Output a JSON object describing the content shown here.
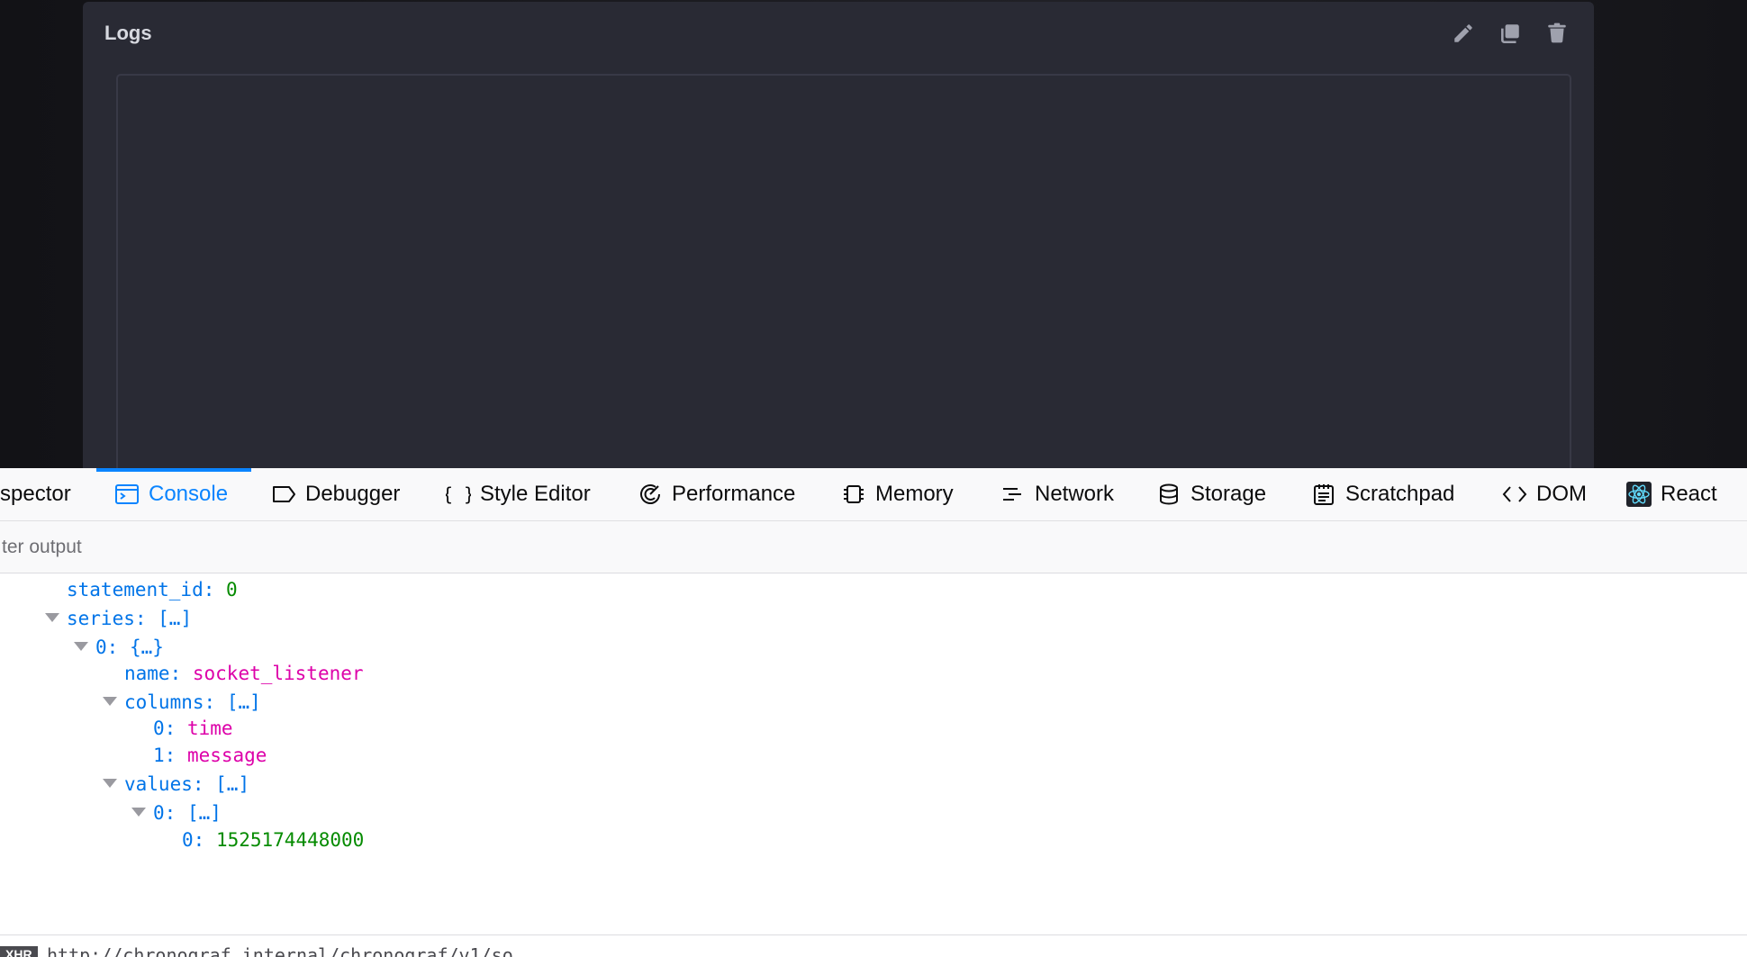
{
  "cell": {
    "title": "Logs",
    "actions": [
      {
        "icon": "pencil-icon"
      },
      {
        "icon": "duplicate-icon"
      },
      {
        "icon": "trash-icon"
      }
    ]
  },
  "devtools": {
    "tabs": [
      {
        "label": "spector",
        "icon": "",
        "active": false
      },
      {
        "label": "Console",
        "icon": "console-icon",
        "active": true
      },
      {
        "label": "Debugger",
        "icon": "debugger-icon",
        "active": false
      },
      {
        "label": "Style Editor",
        "icon": "braces-icon",
        "active": false
      },
      {
        "label": "Performance",
        "icon": "performance-icon",
        "active": false
      },
      {
        "label": "Memory",
        "icon": "memory-icon",
        "active": false
      },
      {
        "label": "Network",
        "icon": "network-icon",
        "active": false
      },
      {
        "label": "Storage",
        "icon": "storage-icon",
        "active": false
      },
      {
        "label": "Scratchpad",
        "icon": "scratchpad-icon",
        "active": false
      },
      {
        "label": "DOM",
        "icon": "dom-icon",
        "active": false
      },
      {
        "label": "React",
        "icon": "react-icon",
        "active": false
      }
    ],
    "filter": {
      "placeholder": "ter output",
      "value": ""
    },
    "console": {
      "lines": [
        {
          "expanded": null,
          "key": "statement_id",
          "value": "0",
          "type": "num"
        },
        {
          "expanded": true,
          "key": "series",
          "value": "[…]",
          "type": "brk"
        },
        {
          "expanded": true,
          "key": "0",
          "value": "{…}",
          "type": "brk"
        },
        {
          "expanded": null,
          "key": "name",
          "value": "socket_listener",
          "type": "str"
        },
        {
          "expanded": true,
          "key": "columns",
          "value": "[…]",
          "type": "brk"
        },
        {
          "expanded": null,
          "key": "0",
          "value": "time",
          "type": "str"
        },
        {
          "expanded": null,
          "key": "1",
          "value": "message",
          "type": "str"
        },
        {
          "expanded": true,
          "key": "values",
          "value": "[…]",
          "type": "brk"
        },
        {
          "expanded": true,
          "key": "0",
          "value": "[…]",
          "type": "brk"
        },
        {
          "expanded": null,
          "key": "0",
          "value": "1525174448000",
          "type": "num"
        }
      ]
    },
    "status": {
      "badge": "XHR",
      "url": "http://chronograf.internal/chronograf/v1/so"
    }
  },
  "colors": {
    "accent": "#0a84ff",
    "key": "#0074e8",
    "number": "#058b00",
    "string": "#dd00a9",
    "app_background": "#292a34"
  }
}
